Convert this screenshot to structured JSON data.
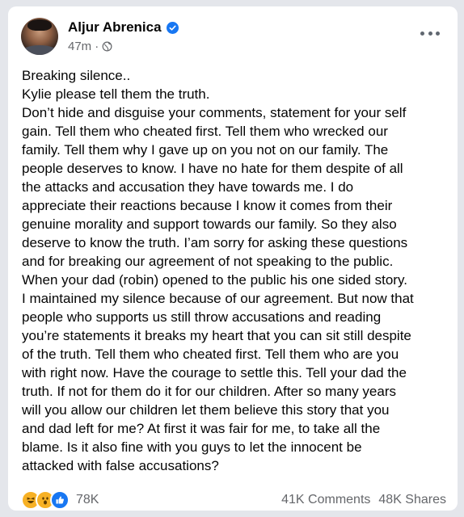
{
  "post": {
    "author": "Aljur Abrenica",
    "time": "47m",
    "separator": "·",
    "privacy_icon": "globe-icon",
    "verified_icon": "verified-badge-icon",
    "more_icon": "more-options-icon",
    "lines": [
      "Breaking silence..",
      "Kylie please tell them the truth.",
      "Don’t hide and disguise your comments, statement for your self",
      "gain. Tell them who cheated first. Tell them who wrecked our",
      "family. Tell them why I gave up on you not on our family. The",
      "people deserves to know. I have no hate for them despite of all",
      "the attacks and accusation they have towards me. I do",
      "appreciate their reactions because I know it comes from their",
      "genuine morality and support towards our family. So they also",
      "deserve to know the truth. I’am sorry for asking these questions",
      "and for breaking our agreement of not speaking to the public.",
      "When your dad (robin) opened to the public his one sided story.",
      "I maintained my silence because of our agreement. But now that",
      "people who supports us still throw accusations and reading",
      "you’re statements it breaks my heart that you can sit still despite",
      "of the truth. Tell them who cheated first. Tell them who are you",
      "with right now. Have the courage to settle this. Tell your dad the",
      "truth. If not for them do it for our children. After so many years",
      "will you allow our children let them believe this story that you",
      "and dad left for me? At first it was fair for me, to take all the",
      "blame. Is it also fine with you guys to let the innocent be",
      "attacked with false accusations?"
    ]
  },
  "footer": {
    "reaction_icons": [
      "haha-icon",
      "wow-icon",
      "like-icon"
    ],
    "reaction_count": "78K",
    "comments": "41K Comments",
    "shares": "48K Shares"
  },
  "colors": {
    "primary_text": "#050505",
    "secondary_text": "#65676b",
    "facebook_blue": "#1877f2",
    "reaction_yellow": "#f7b125"
  }
}
